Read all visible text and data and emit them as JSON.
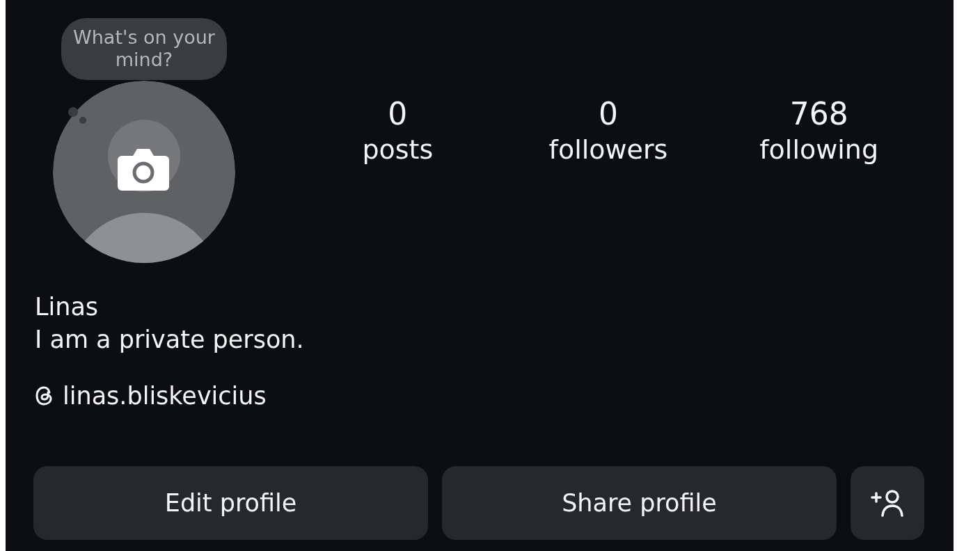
{
  "avatar": {
    "note": "What's on your mind?"
  },
  "stats": [
    {
      "value": "0",
      "label": "posts"
    },
    {
      "value": "0",
      "label": "followers"
    },
    {
      "value": "768",
      "label": "following"
    }
  ],
  "name": "Linas",
  "bio": "I am a private person.",
  "threads_handle": "linas.bliskevicius",
  "buttons": [
    {
      "kind": "text",
      "label": "Edit profile"
    },
    {
      "kind": "text",
      "label": "Share profile"
    },
    {
      "kind": "add-person"
    }
  ]
}
